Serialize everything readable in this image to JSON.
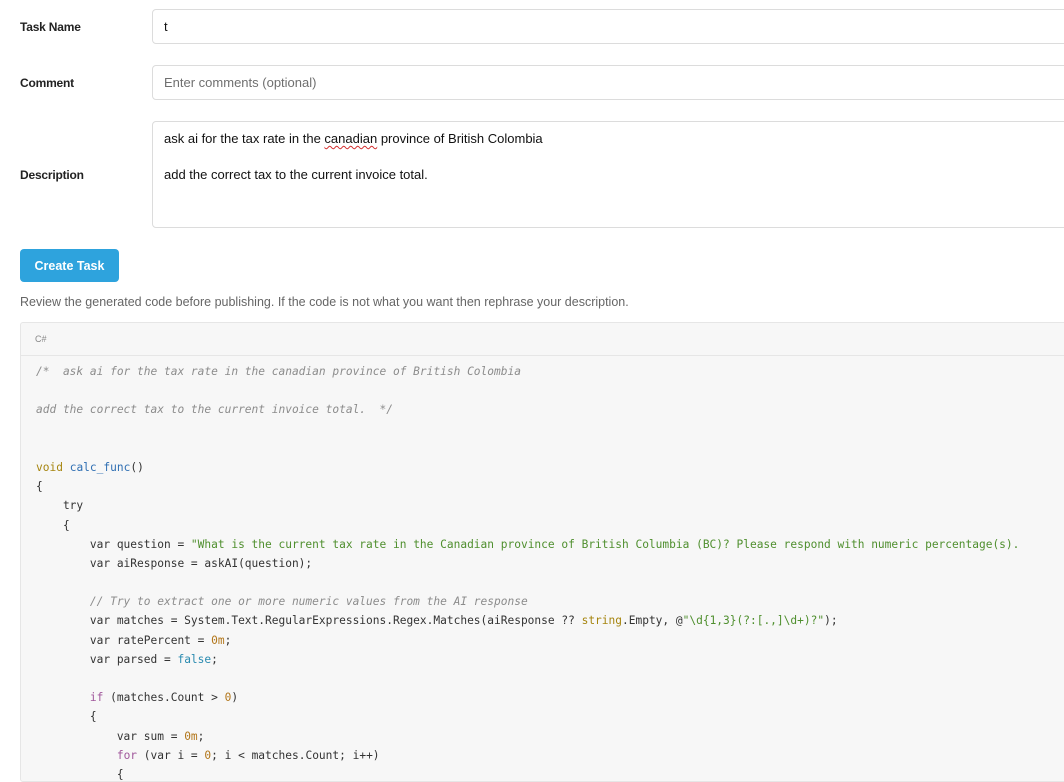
{
  "form": {
    "task_name_label": "Task Name",
    "task_name_value": "t",
    "comment_label": "Comment",
    "comment_placeholder": "Enter comments (optional)",
    "description_label": "Description",
    "description_line1_prefix": "ask ai for the tax rate in the ",
    "description_line1_flagged": "canadian",
    "description_line1_suffix": " province of British Colombia",
    "description_line2": "add the correct tax to the current invoice total.",
    "create_button": "Create Task",
    "review_hint": "Review the generated code before publishing. If the code is not what you want then rephrase your description."
  },
  "code_panel": {
    "language": "C#",
    "lines": [
      [
        {
          "t": "/*  ask ai for the tax rate in the canadian province of British Colombia",
          "c": "cm"
        }
      ],
      [],
      [
        {
          "t": "add the correct tax to the current invoice total.  */",
          "c": "cm"
        }
      ],
      [],
      [],
      [
        {
          "t": "void",
          "c": "ty"
        },
        {
          "t": " "
        },
        {
          "t": "calc_func",
          "c": "fn"
        },
        {
          "t": "()"
        }
      ],
      [
        {
          "t": "{"
        }
      ],
      [
        {
          "t": "    try"
        }
      ],
      [
        {
          "t": "    {"
        }
      ],
      [
        {
          "t": "        var question = "
        },
        {
          "t": "\"What is the current tax rate in the Canadian province of British Columbia (BC)? Please respond with numeric percentage(s).",
          "c": "st"
        }
      ],
      [
        {
          "t": "        var aiResponse = askAI(question);"
        }
      ],
      [],
      [
        {
          "t": "        // Try to extract one or more numeric values from the AI response",
          "c": "cm"
        }
      ],
      [
        {
          "t": "        var matches = System.Text.RegularExpressions.Regex.Matches(aiResponse ?? "
        },
        {
          "t": "string",
          "c": "ty"
        },
        {
          "t": ".Empty, @"
        },
        {
          "t": "\"\\d{1,3}(?:[.,]\\d+)?\"",
          "c": "st"
        },
        {
          "t": ");"
        }
      ],
      [
        {
          "t": "        var ratePercent = "
        },
        {
          "t": "0m",
          "c": "nu"
        },
        {
          "t": ";"
        }
      ],
      [
        {
          "t": "        var parsed = "
        },
        {
          "t": "false",
          "c": "bo"
        },
        {
          "t": ";"
        }
      ],
      [],
      [
        {
          "t": "        "
        },
        {
          "t": "if",
          "c": "kw"
        },
        {
          "t": " (matches.Count > "
        },
        {
          "t": "0",
          "c": "nu"
        },
        {
          "t": ")"
        }
      ],
      [
        {
          "t": "        {"
        }
      ],
      [
        {
          "t": "            var sum = "
        },
        {
          "t": "0m",
          "c": "nu"
        },
        {
          "t": ";"
        }
      ],
      [
        {
          "t": "            "
        },
        {
          "t": "for",
          "c": "kw"
        },
        {
          "t": " (var i = "
        },
        {
          "t": "0",
          "c": "nu"
        },
        {
          "t": "; i < matches.Count; i++)"
        }
      ],
      [
        {
          "t": "            {"
        }
      ]
    ]
  }
}
